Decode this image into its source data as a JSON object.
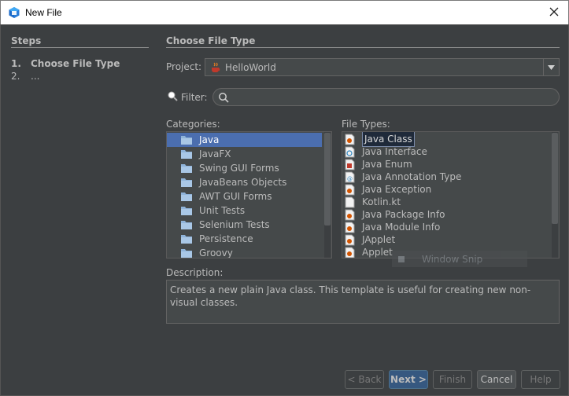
{
  "window": {
    "title": "New File"
  },
  "steps": {
    "heading": "Steps",
    "items": [
      {
        "num": "1.",
        "label": "Choose File Type"
      },
      {
        "num": "2.",
        "label": "..."
      }
    ]
  },
  "main": {
    "heading": "Choose File Type",
    "project_label": "Project:",
    "project_value": "HelloWorld",
    "filter_label": "Filter:",
    "filter_value": "",
    "categories_label": "Categories:",
    "categories": [
      "Java",
      "JavaFX",
      "Swing GUI Forms",
      "JavaBeans Objects",
      "AWT GUI Forms",
      "Unit Tests",
      "Selenium Tests",
      "Persistence",
      "Groovy"
    ],
    "file_types_label": "File Types:",
    "file_types": [
      "Java Class",
      "Java Interface",
      "Java Enum",
      "Java Annotation Type",
      "Java Exception",
      "Kotlin.kt",
      "Java Package Info",
      "Java Module Info",
      "JApplet",
      "Applet"
    ],
    "description_label": "Description:",
    "description": "Creates a new plain Java class. This template is useful for creating new non-visual classes."
  },
  "overlay": {
    "snip_label": "Window Snip"
  },
  "buttons": {
    "back": "< Back",
    "next": "Next >",
    "finish": "Finish",
    "cancel": "Cancel",
    "help": "Help"
  }
}
